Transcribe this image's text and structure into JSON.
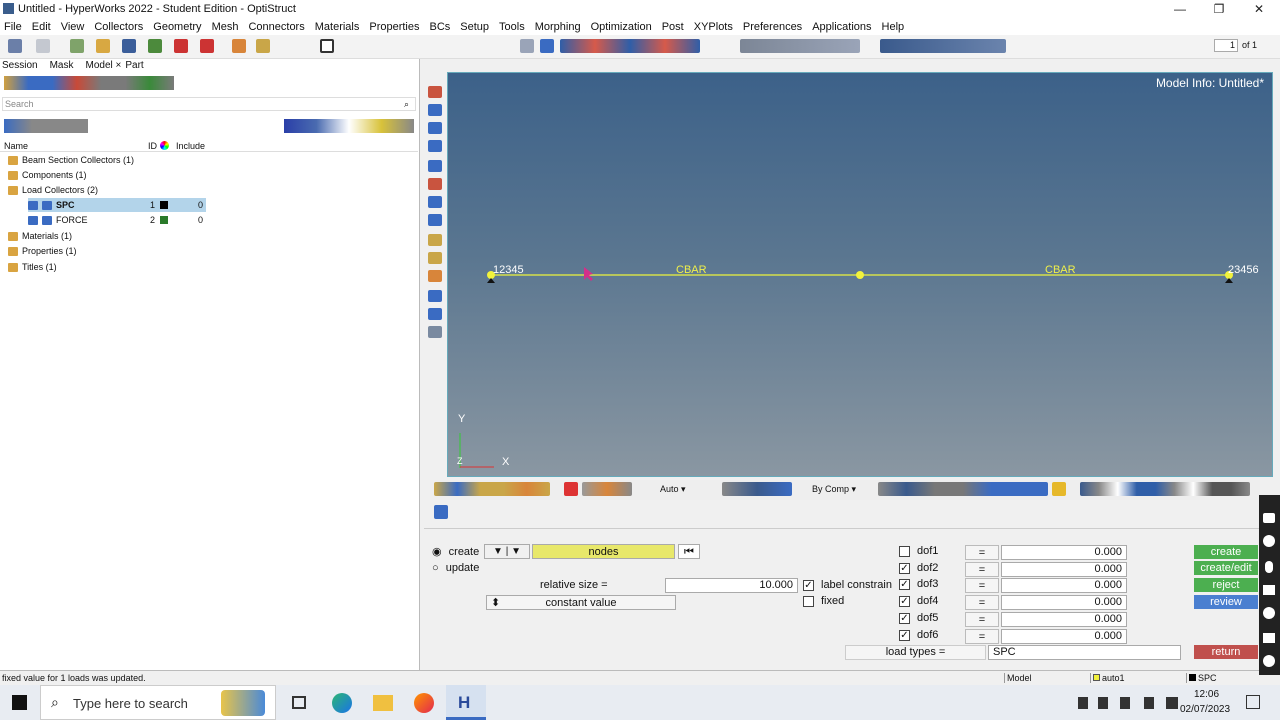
{
  "window": {
    "title": "Untitled - HyperWorks 2022 - Student Edition - OptiStruct"
  },
  "menu": [
    "File",
    "Edit",
    "View",
    "Collectors",
    "Geometry",
    "Mesh",
    "Connectors",
    "Materials",
    "Properties",
    "BCs",
    "Setup",
    "Tools",
    "Morphing",
    "Optimization",
    "Post",
    "XYPlots",
    "Preferences",
    "Applications",
    "Help"
  ],
  "page": {
    "value": "1",
    "of": "of 1"
  },
  "browser": {
    "tabs": [
      "Session",
      "Mask",
      "Model ×",
      "Part"
    ],
    "search_placeholder": "Search",
    "headers": {
      "name": "Name",
      "id": "ID",
      "include": "Include"
    },
    "items": [
      {
        "label": "Beam Section Collectors (1)"
      },
      {
        "label": "Components (1)"
      },
      {
        "label": "Load Collectors (2)"
      },
      {
        "label": "SPC",
        "id": "1",
        "inc": "0",
        "color": "#000000"
      },
      {
        "label": "FORCE",
        "id": "2",
        "inc": "0",
        "color": "#2a7a2a"
      },
      {
        "label": "Materials (1)"
      },
      {
        "label": "Properties (1)"
      },
      {
        "label": "Titles (1)"
      }
    ]
  },
  "viewport": {
    "model_info": "Model Info: Untitled*",
    "node_left": "12345",
    "node_right": "23456",
    "elem1": "CBAR",
    "elem2": "CBAR",
    "axis_y": "Y",
    "axis_x": "X",
    "axis_z": "Z"
  },
  "vtoolbar": {
    "auto": "Auto",
    "bycomp": "By Comp"
  },
  "panel": {
    "create": "create",
    "update": "update",
    "nodes": "nodes",
    "relsize_label": "relative size =",
    "relsize_value": "10.000",
    "const_value": "constant value",
    "label_constraints": "label constrain",
    "fixed": "fixed",
    "dofs": [
      {
        "name": "dof1",
        "checked": false,
        "value": "0.000"
      },
      {
        "name": "dof2",
        "checked": true,
        "value": "0.000"
      },
      {
        "name": "dof3",
        "checked": true,
        "value": "0.000"
      },
      {
        "name": "dof4",
        "checked": true,
        "value": "0.000"
      },
      {
        "name": "dof5",
        "checked": true,
        "value": "0.000"
      },
      {
        "name": "dof6",
        "checked": true,
        "value": "0.000"
      }
    ],
    "eq": "=",
    "load_types_label": "load types =",
    "load_types_value": "SPC",
    "btn_create": "create",
    "btn_createedit": "create/edit",
    "btn_reject": "reject",
    "btn_review": "review",
    "btn_return": "return"
  },
  "status": {
    "message": "fixed value for 1 loads was updated.",
    "model": "Model",
    "auto": "auto1",
    "spc": "SPC"
  },
  "taskbar": {
    "search": "Type here to search",
    "time": "12:06",
    "date": "02/07/2023"
  }
}
